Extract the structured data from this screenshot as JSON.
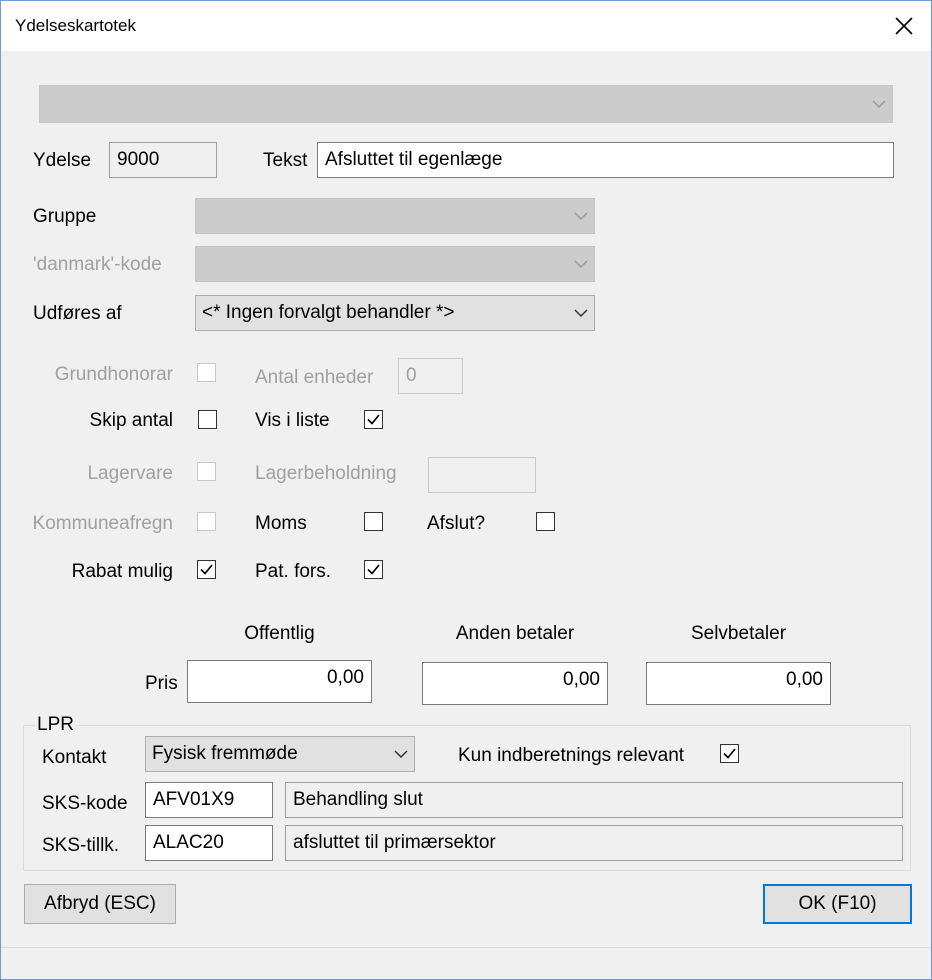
{
  "window": {
    "title": "Ydelseskartotek",
    "close_icon": "close-icon"
  },
  "top_combo": {
    "value": ""
  },
  "ydelse": {
    "label": "Ydelse",
    "value": "9000"
  },
  "tekst": {
    "label": "Tekst",
    "value": "Afsluttet til egenlæge"
  },
  "gruppe": {
    "label": "Gruppe",
    "value": ""
  },
  "danmark_kode": {
    "label": "'danmark'-kode",
    "value": ""
  },
  "udfoeres_af": {
    "label": "Udføres af",
    "value": "<* Ingen forvalgt behandler *>"
  },
  "grundhonorar": {
    "label": "Grundhonorar",
    "checked": false
  },
  "antal_enheder": {
    "label": "Antal enheder",
    "value": "0"
  },
  "skip_antal": {
    "label": "Skip antal",
    "checked": false
  },
  "vis_i_liste": {
    "label": "Vis i liste",
    "checked": true
  },
  "lagervare": {
    "label": "Lagervare",
    "checked": false
  },
  "lagerbeholdning": {
    "label": "Lagerbeholdning",
    "value": ""
  },
  "kommuneafregn": {
    "label": "Kommuneafregn",
    "checked": false
  },
  "moms": {
    "label": "Moms",
    "checked": false
  },
  "afslut": {
    "label": "Afslut?",
    "checked": false
  },
  "rabat_mulig": {
    "label": "Rabat mulig",
    "checked": true
  },
  "pat_fors": {
    "label": "Pat. fors.",
    "checked": true
  },
  "price": {
    "row_label": "Pris",
    "offentlig": {
      "header": "Offentlig",
      "value": "0,00"
    },
    "anden_betaler": {
      "header": "Anden betaler",
      "value": "0,00"
    },
    "selvbetaler": {
      "header": "Selvbetaler",
      "value": "0,00"
    }
  },
  "lpr": {
    "title": "LPR",
    "kontakt": {
      "label": "Kontakt",
      "value": "Fysisk fremmøde"
    },
    "kun_indberetnings": {
      "label": "Kun indberetnings relevant",
      "checked": true
    },
    "sks_kode": {
      "label": "SKS-kode",
      "code": "AFV01X9",
      "description": "Behandling slut"
    },
    "sks_tillk": {
      "label": "SKS-tillk.",
      "code": "ALAC20",
      "description": "afsluttet til primærsektor"
    }
  },
  "buttons": {
    "cancel_label": "Afbryd (ESC)",
    "ok_label": "OK (F10)"
  },
  "colors": {
    "accent": "#0078d7",
    "window_bg": "#f0f0f0",
    "disabled_text": "#a0a0a0"
  }
}
